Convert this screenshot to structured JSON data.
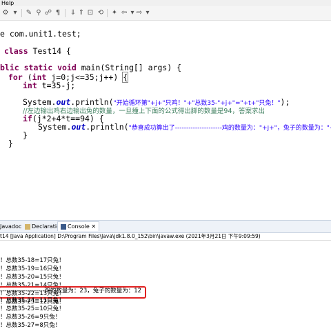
{
  "menubar": {
    "help": "Help"
  },
  "toolbar": {
    "icons": [
      "gear-icon",
      "run-icon",
      "search-icon",
      "annotation-icon",
      "back-icon",
      "forward-icon"
    ]
  },
  "editor": {
    "line1": "e com.unit1.test;",
    "line2_kw": "class",
    "line2_rest": " Test14 {",
    "line3_kw": "blic static void",
    "line3_rest": " main(String[] args) {",
    "line4_for": "for",
    "line4_int": "int",
    "line4_rest1": " (",
    "line4_rest2": " j=0;j<=35;j++) ",
    "line4_brace": "{",
    "line5_int": "int",
    "line5_rest": " t=35-j;",
    "line6_pre": "System.",
    "line6_out": "out",
    "line6_mid": ".println(",
    "line6_str": "\"开始循环第\"+j+\"只鸡！\"+\"总数35-\"+j+\"=\"+t+\"只兔！\"",
    "line6_end": ");",
    "line7_comment": "//左边输出鸡右边输出兔的数量，一旦撞上下面的公式得出脚的数量是94，答案求出",
    "line8_if": "if",
    "line8_rest": "(j*2+4*t==94) {",
    "line9_pre": "System.",
    "line9_out": "out",
    "line9_mid": ".println(",
    "line9_str": "\"恭喜成功算出了---------------------鸡的数量为：\"+j+\"，兔子的数量为：\"+t",
    "line9_end": ");",
    "line10": "}",
    "line11": "}"
  },
  "views": {
    "javadoc": "Javadoc",
    "declaration": "Declaration",
    "console": "Console"
  },
  "console": {
    "info": "t14 [Java Application] D:\\Program Files\\Java\\jdk1.8.0_152\\bin\\javaw.exe (2021年3月21日 下午9:09:59)",
    "lines": [
      "！总数35-18=17只兔！",
      "！总数35-19=16只兔！",
      "！总数35-20=15只兔！",
      "！总数35-21=14只兔！",
      "！总数35-22=13只兔！",
      "！总数35-23=12只兔！",
      "---------------------鸡的数量为：23，兔子的数量为：12",
      "！总数35-24=11只兔！",
      "！总数35-25=10只兔！",
      "！总数35-26=9只兔！",
      "！总数35-27=8只兔！",
      "！总数35-28=7只兔！"
    ]
  }
}
